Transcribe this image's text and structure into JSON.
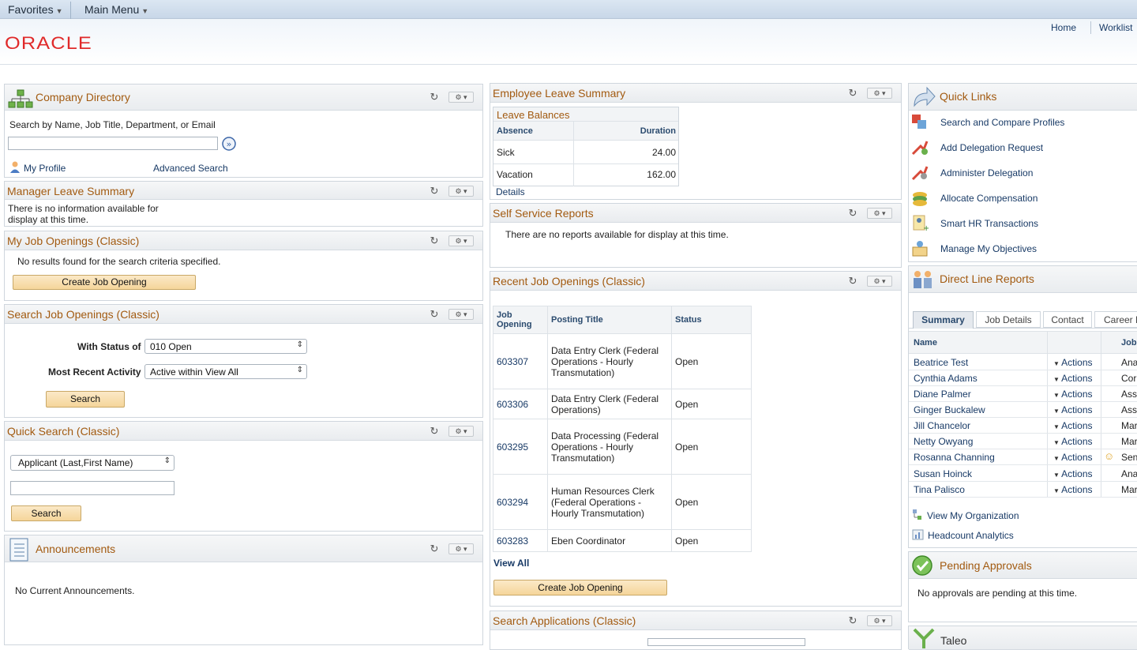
{
  "menubar": {
    "favorites": "Favorites",
    "main_menu": "Main Menu"
  },
  "brand": {
    "logo": "ORACLE"
  },
  "header_links": {
    "home": "Home",
    "worklist": "Worklist"
  },
  "company_directory": {
    "title": "Company Directory",
    "search_label": "Search by Name, Job Title, Department, or Email",
    "search_value": "",
    "my_profile": "My Profile",
    "advanced_search": "Advanced Search"
  },
  "manager_leave": {
    "title": "Manager Leave Summary",
    "message": "There is no information available for display at this time.",
    "line1": "There is no information available for",
    "line2": "display at this time."
  },
  "my_job_openings": {
    "title": "My Job Openings (Classic)",
    "message": "No results found for the search criteria specified.",
    "button": "Create Job Opening"
  },
  "search_job_openings": {
    "title": "Search Job Openings (Classic)",
    "status_label": "With Status of",
    "status_value": "010 Open",
    "activity_label": "Most Recent Activity",
    "activity_value": "Active within View All",
    "button": "Search"
  },
  "quick_search": {
    "title": "Quick Search (Classic)",
    "select_value": "Applicant (Last,First Name)",
    "input_value": "",
    "button": "Search"
  },
  "announcements": {
    "title": "Announcements",
    "message": "No Current Announcements."
  },
  "employee_leave": {
    "title": "Employee Leave Summary",
    "table_title": "Leave Balances",
    "col_absence": "Absence",
    "col_duration": "Duration",
    "rows": [
      {
        "absence": "Sick",
        "duration": "24.00"
      },
      {
        "absence": "Vacation",
        "duration": "162.00"
      }
    ],
    "details": "Details"
  },
  "self_service_reports": {
    "title": "Self Service Reports",
    "message": "There are no reports available for display at this time."
  },
  "recent_job_openings": {
    "title": "Recent Job Openings (Classic)",
    "col_job_opening_1": "Job",
    "col_job_opening_2": "Opening",
    "col_posting_title": "Posting Title",
    "col_status": "Status",
    "rows": [
      {
        "id": "603307",
        "title1": "Data Entry Clerk (Federal",
        "title2": "Operations - Hourly",
        "title3": "Transmutation)",
        "status": "Open"
      },
      {
        "id": "603306",
        "title1": "Data Entry Clerk (Federal",
        "title2": "Operations)",
        "title3": "",
        "status": "Open"
      },
      {
        "id": "603295",
        "title1": "Data Processing (Federal",
        "title2": "Operations - Hourly",
        "title3": "Transmutation)",
        "status": "Open"
      },
      {
        "id": "603294",
        "title1": "Human Resources Clerk",
        "title2": "(Federal Operations -",
        "title3": "Hourly Transmutation)",
        "status": "Open"
      },
      {
        "id": "603283",
        "title1": "Eben Coordinator",
        "title2": "",
        "title3": "",
        "status": "Open"
      }
    ],
    "view_all": "View All",
    "button": "Create Job Opening"
  },
  "search_applications": {
    "title": "Search Applications (Classic)"
  },
  "quick_links": {
    "title": "Quick Links",
    "items": [
      {
        "label": "Search and Compare Profiles",
        "icon": "search-profiles-icon"
      },
      {
        "label": "Add Delegation Request",
        "icon": "add-delegation-icon"
      },
      {
        "label": "Administer Delegation",
        "icon": "administer-delegation-icon"
      },
      {
        "label": "Allocate Compensation",
        "icon": "allocate-compensation-icon"
      },
      {
        "label": "Smart HR Transactions",
        "icon": "smart-hr-icon"
      },
      {
        "label": "Manage My Objectives",
        "icon": "objectives-icon"
      }
    ]
  },
  "direct_line_reports": {
    "title": "Direct Line Reports",
    "tabs": [
      "Summary",
      "Job Details",
      "Contact",
      "Career F"
    ],
    "col_name": "Name",
    "col_job": "Job",
    "actions_label": "Actions",
    "rows": [
      {
        "name": "Beatrice Test",
        "job": "Ana"
      },
      {
        "name": "Cynthia Adams",
        "job": "Cor"
      },
      {
        "name": "Diane Palmer",
        "job": "Ass"
      },
      {
        "name": "Ginger Buckalew",
        "job": "Ass"
      },
      {
        "name": "Jill Chancelor",
        "job": "Mar"
      },
      {
        "name": "Netty Owyang",
        "job": "Mar"
      },
      {
        "name": "Rosanna Channing",
        "job": "Sen"
      },
      {
        "name": "Susan Hoinck",
        "job": "Ana"
      },
      {
        "name": "Tina Palisco",
        "job": "Mar"
      }
    ],
    "view_org": "View My Organization",
    "headcount": "Headcount Analytics"
  },
  "pending_approvals": {
    "title": "Pending Approvals",
    "message": "No approvals are pending at this time."
  },
  "taleo": {
    "title": "Taleo"
  },
  "colors": {
    "title_orange": "#a25a10",
    "link_blue": "#183a66",
    "oracle_red": "#e02a2a",
    "button_fill": "#f5d59a"
  }
}
